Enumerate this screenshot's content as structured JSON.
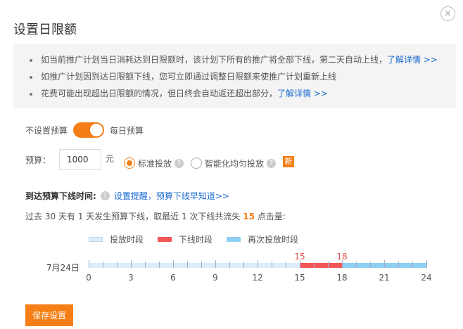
{
  "dialog": {
    "title": "设置日限额",
    "close": "×"
  },
  "notice": [
    {
      "text": "如当前推广计划当日消耗达到日限额时，该计划下所有的推广将全部下线，第二天自动上线，",
      "link": "了解详情 >>"
    },
    {
      "text": "如推广计划因到达日限额下线，您可立即通过调整日限额来使推广计划重新上线",
      "link": ""
    },
    {
      "text": "花费可能出现超出日限额的情况，但日终会自动返还超出部分，",
      "link": "了解详情 >>"
    }
  ],
  "budget_toggle": {
    "off_label": "不设置预算",
    "on_label": "每日预算",
    "on": true
  },
  "budget": {
    "label": "预算：",
    "value": "1000",
    "unit": "元",
    "options": [
      "标准投放",
      "智能化均匀投放"
    ],
    "selected": 0,
    "new_badge": "新"
  },
  "offline": {
    "heading": "到达预算下线时间:",
    "link": "设置提醒，预算下线早知道>>",
    "desc_pre": "过去 30 天有 1 天发生预算下线，取最近 1 次下线共流失 ",
    "lost": "15",
    "desc_post": " 点击量:"
  },
  "chart_data": {
    "type": "timeline",
    "date": "7月24日",
    "legend": [
      {
        "name": "投放时段",
        "color": "#dcecf8"
      },
      {
        "name": "下线时段",
        "color": "#f25656"
      },
      {
        "name": "再次投放时段",
        "color": "#8ecff3"
      }
    ],
    "segments": [
      {
        "start": 0,
        "end": 15,
        "type": 0
      },
      {
        "start": 15,
        "end": 18,
        "type": 1
      },
      {
        "start": 18,
        "end": 24,
        "type": 2
      }
    ],
    "markers": [
      "15",
      "18"
    ],
    "ticks": [
      "0",
      "3",
      "6",
      "9",
      "12",
      "15",
      "18",
      "21",
      "24"
    ],
    "xlim": [
      0,
      24
    ]
  },
  "save_label": "保存设置"
}
